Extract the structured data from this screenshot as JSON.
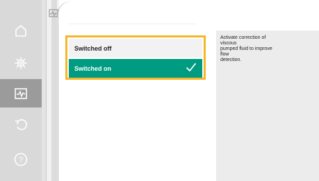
{
  "sidebar": {
    "items": [
      {
        "icon": "home-icon",
        "active": false
      },
      {
        "icon": "gear-icon",
        "active": false
      },
      {
        "icon": "diagnostics-icon",
        "active": true
      },
      {
        "icon": "undo-icon",
        "active": false
      },
      {
        "icon": "help-icon",
        "active": false
      }
    ]
  },
  "options": {
    "items": [
      {
        "label": "Switched off",
        "selected": false
      },
      {
        "label": "Switched on",
        "selected": true
      }
    ]
  },
  "help": {
    "lines": [
      "Activate correction of",
      "viscous",
      "pumped fluid to improve",
      "flow",
      "detection."
    ]
  },
  "colors": {
    "accent": "#009c82",
    "focus_border": "#f6b628",
    "sidebar_bg": "#d9d9d9",
    "sidebar_active": "#9b9b9b",
    "help_bg": "#ececec"
  }
}
